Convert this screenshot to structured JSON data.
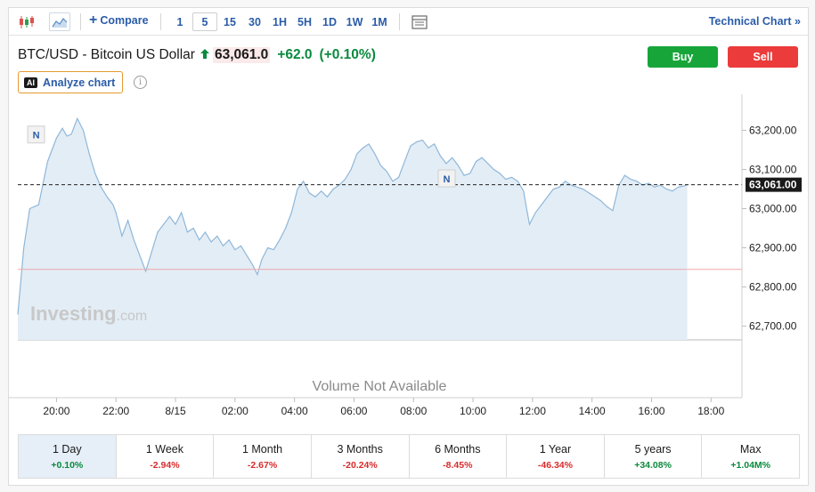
{
  "toolbar": {
    "compare_label": "Compare",
    "intervals": [
      "1",
      "5",
      "15",
      "30",
      "1H",
      "5H",
      "1D",
      "1W",
      "1M"
    ],
    "active_interval": "5",
    "technical_chart_label": "Technical Chart",
    "technical_chart_arrow": "»"
  },
  "header": {
    "instrument": "BTC/USD - Bitcoin US Dollar",
    "price": "63,061.0",
    "change": "+62.0",
    "change_pct": "(+0.10%)",
    "buy_label": "Buy",
    "sell_label": "Sell",
    "analyze_badge": "AI",
    "analyze_label": "Analyze chart",
    "info_glyph": "i"
  },
  "colors": {
    "line": "#8fb7d9",
    "area": "#e3edf6",
    "positive": "#0b8a3e",
    "negative": "#d92b2b",
    "buy": "#17a53a",
    "sell": "#ec3b3b",
    "accent": "#2a5ca8"
  },
  "chart_data": {
    "type": "area",
    "x_labels": [
      "20:00",
      "22:00",
      "8/15",
      "02:00",
      "04:00",
      "06:00",
      "08:00",
      "10:00",
      "12:00",
      "14:00",
      "16:00",
      "18:00"
    ],
    "y_ticks": [
      "63,200.00",
      "63,100.00",
      "63,000.00",
      "62,900.00",
      "62,800.00",
      "62,700.00"
    ],
    "y_tick_values": [
      63200,
      63100,
      63000,
      62900,
      62800,
      62700
    ],
    "ylim": [
      62665,
      63260
    ],
    "x_range_hours": [
      -1.3,
      22.8
    ],
    "current_price": 63061,
    "current_price_label": "63,061.00",
    "reference_price": 62845,
    "watermark": "Investing",
    "watermark_suffix": ".com",
    "volume_text": "Volume Not Available",
    "news_markers": [
      {
        "label": "N",
        "x": -0.7,
        "y": 63188
      },
      {
        "label": "N",
        "x": 13.1,
        "y": 63076
      }
    ],
    "series": [
      {
        "points": [
          [
            -1.3,
            62730
          ],
          [
            -1.1,
            62900
          ],
          [
            -0.9,
            63000
          ],
          [
            -0.6,
            63010
          ],
          [
            -0.3,
            63120
          ],
          [
            0.0,
            63180
          ],
          [
            0.2,
            63205
          ],
          [
            0.35,
            63185
          ],
          [
            0.5,
            63190
          ],
          [
            0.7,
            63230
          ],
          [
            0.9,
            63200
          ],
          [
            1.1,
            63140
          ],
          [
            1.3,
            63090
          ],
          [
            1.5,
            63055
          ],
          [
            1.7,
            63030
          ],
          [
            1.9,
            63010
          ],
          [
            2.0,
            62990
          ],
          [
            2.2,
            62930
          ],
          [
            2.4,
            62970
          ],
          [
            2.6,
            62920
          ],
          [
            2.8,
            62880
          ],
          [
            3.0,
            62840
          ],
          [
            3.2,
            62890
          ],
          [
            3.4,
            62940
          ],
          [
            3.6,
            62960
          ],
          [
            3.8,
            62980
          ],
          [
            4.0,
            62960
          ],
          [
            4.2,
            62990
          ],
          [
            4.4,
            62940
          ],
          [
            4.6,
            62950
          ],
          [
            4.8,
            62920
          ],
          [
            5.0,
            62940
          ],
          [
            5.2,
            62915
          ],
          [
            5.4,
            62930
          ],
          [
            5.6,
            62905
          ],
          [
            5.8,
            62920
          ],
          [
            6.0,
            62895
          ],
          [
            6.2,
            62905
          ],
          [
            6.4,
            62880
          ],
          [
            6.6,
            62855
          ],
          [
            6.75,
            62832
          ],
          [
            6.9,
            62870
          ],
          [
            7.1,
            62900
          ],
          [
            7.3,
            62895
          ],
          [
            7.5,
            62920
          ],
          [
            7.7,
            62950
          ],
          [
            7.9,
            62990
          ],
          [
            8.1,
            63050
          ],
          [
            8.3,
            63070
          ],
          [
            8.5,
            63040
          ],
          [
            8.7,
            63030
          ],
          [
            8.9,
            63045
          ],
          [
            9.1,
            63030
          ],
          [
            9.3,
            63050
          ],
          [
            9.5,
            63060
          ],
          [
            9.7,
            63075
          ],
          [
            9.9,
            63100
          ],
          [
            10.1,
            63140
          ],
          [
            10.3,
            63155
          ],
          [
            10.5,
            63165
          ],
          [
            10.7,
            63140
          ],
          [
            10.9,
            63110
          ],
          [
            11.1,
            63095
          ],
          [
            11.3,
            63070
          ],
          [
            11.5,
            63080
          ],
          [
            11.7,
            63120
          ],
          [
            11.9,
            63160
          ],
          [
            12.1,
            63170
          ],
          [
            12.3,
            63175
          ],
          [
            12.5,
            63155
          ],
          [
            12.7,
            63165
          ],
          [
            12.9,
            63135
          ],
          [
            13.1,
            63115
          ],
          [
            13.3,
            63130
          ],
          [
            13.5,
            63110
          ],
          [
            13.7,
            63085
          ],
          [
            13.9,
            63090
          ],
          [
            14.1,
            63120
          ],
          [
            14.3,
            63130
          ],
          [
            14.5,
            63115
          ],
          [
            14.7,
            63100
          ],
          [
            14.9,
            63090
          ],
          [
            15.1,
            63075
          ],
          [
            15.3,
            63080
          ],
          [
            15.5,
            63070
          ],
          [
            15.7,
            63045
          ],
          [
            15.8,
            63000
          ],
          [
            15.9,
            62960
          ],
          [
            16.1,
            62990
          ],
          [
            16.3,
            63010
          ],
          [
            16.5,
            63030
          ],
          [
            16.7,
            63050
          ],
          [
            16.9,
            63055
          ],
          [
            17.1,
            63070
          ],
          [
            17.3,
            63060
          ],
          [
            17.5,
            63055
          ],
          [
            17.7,
            63050
          ],
          [
            17.9,
            63040
          ],
          [
            18.1,
            63030
          ],
          [
            18.3,
            63020
          ],
          [
            18.5,
            63005
          ],
          [
            18.7,
            62995
          ],
          [
            18.9,
            63060
          ],
          [
            19.1,
            63085
          ],
          [
            19.3,
            63075
          ],
          [
            19.5,
            63070
          ],
          [
            19.7,
            63060
          ],
          [
            19.9,
            63065
          ],
          [
            20.1,
            63055
          ],
          [
            20.3,
            63060
          ],
          [
            20.5,
            63050
          ],
          [
            20.7,
            63045
          ],
          [
            20.9,
            63055
          ],
          [
            21.1,
            63058
          ],
          [
            21.2,
            63061
          ]
        ]
      }
    ]
  },
  "periods": [
    {
      "label": "1 Day",
      "value": "+0.10%",
      "dir": "pos",
      "active": true
    },
    {
      "label": "1 Week",
      "value": "-2.94%",
      "dir": "neg",
      "active": false
    },
    {
      "label": "1 Month",
      "value": "-2.67%",
      "dir": "neg",
      "active": false
    },
    {
      "label": "3 Months",
      "value": "-20.24%",
      "dir": "neg",
      "active": false
    },
    {
      "label": "6 Months",
      "value": "-8.45%",
      "dir": "neg",
      "active": false
    },
    {
      "label": "1 Year",
      "value": "-46.34%",
      "dir": "neg",
      "active": false
    },
    {
      "label": "5 years",
      "value": "+34.08%",
      "dir": "pos",
      "active": false
    },
    {
      "label": "Max",
      "value": "+1.04M%",
      "dir": "pos",
      "active": false
    }
  ]
}
